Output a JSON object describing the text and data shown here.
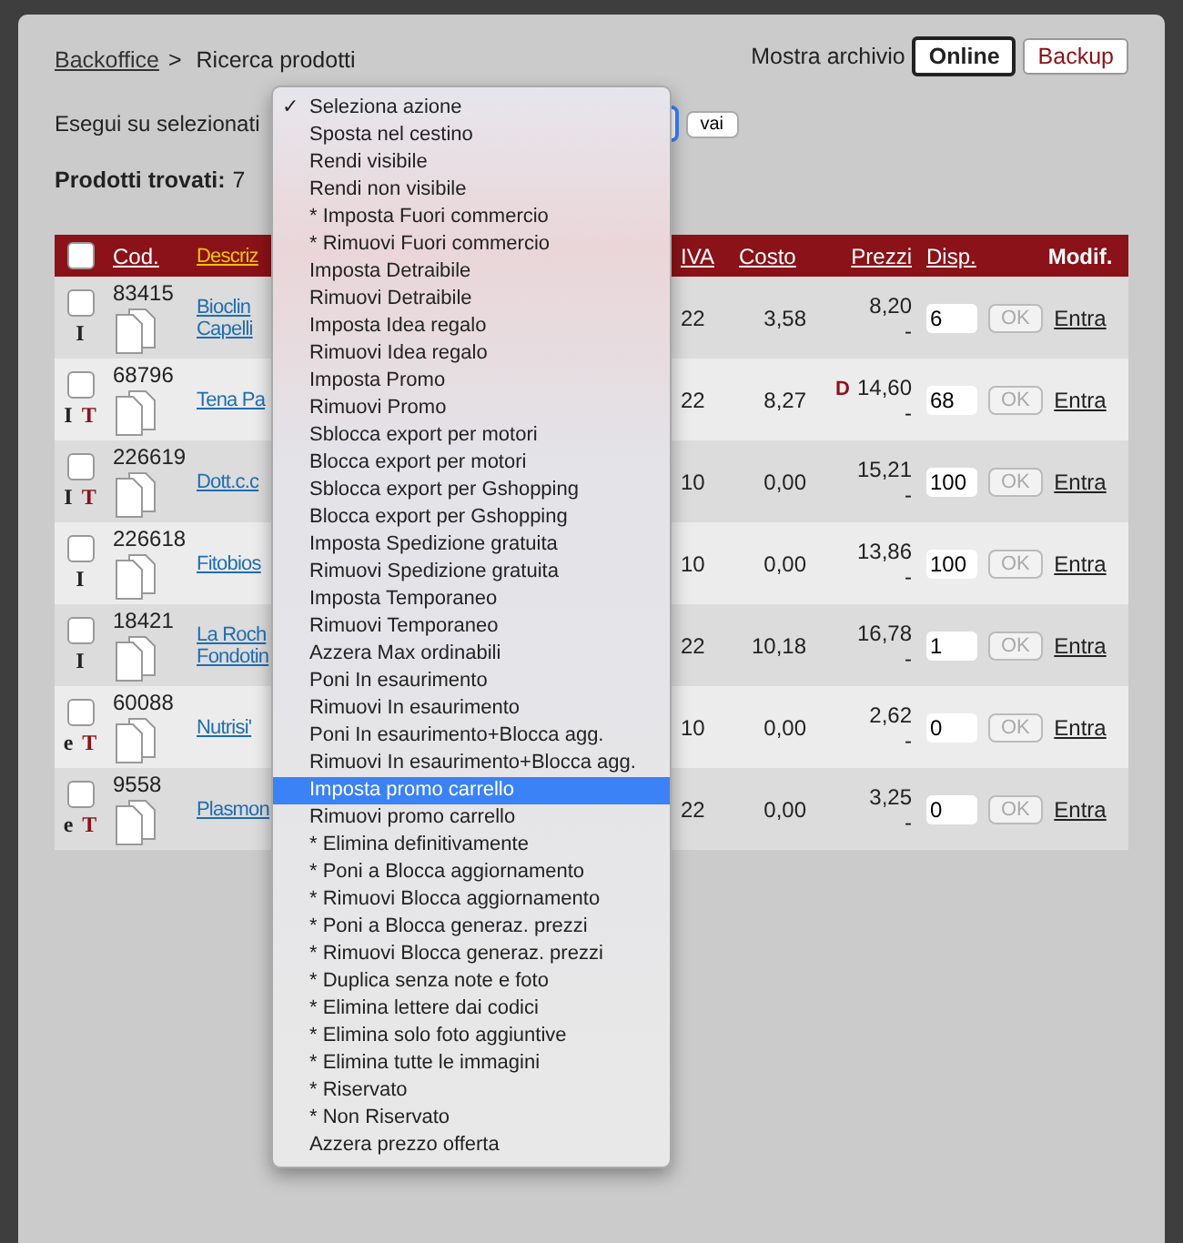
{
  "breadcrumb": {
    "link": "Backoffice",
    "separator": ">",
    "current": "Ricerca prodotti"
  },
  "archive": {
    "label": "Mostra archivio",
    "options": [
      {
        "label": "Online",
        "selected": true
      },
      {
        "label": "Backup",
        "selected": false
      }
    ]
  },
  "action_bar": {
    "label": "Esegui su selezionati",
    "go_button": "vai"
  },
  "found": {
    "label": "Prodotti trovati:",
    "count": "7"
  },
  "table": {
    "select_all_checked": false,
    "columns": [
      {
        "label": "Cod.",
        "sorted": false
      },
      {
        "label": "Descriz",
        "sorted": true
      },
      {
        "label": "IVA",
        "sorted": false
      },
      {
        "label": "Costo",
        "sorted": false
      },
      {
        "label": "Prezzi",
        "sorted": false
      },
      {
        "label": "Disp.",
        "sorted": false
      },
      {
        "label": "Modif.",
        "sorted": false
      }
    ],
    "rows": [
      {
        "checked": false,
        "flags": [
          {
            "label": "I",
            "kind": "plain"
          }
        ],
        "code": "83415",
        "description": [
          "Bioclin",
          "Capelli"
        ],
        "iva": "22",
        "cost": "3,58",
        "price_flag": "",
        "price": "8,20",
        "price_sub": "-",
        "stock": "6",
        "ok": "OK",
        "edit": "Entra"
      },
      {
        "checked": false,
        "flags": [
          {
            "label": "I",
            "kind": "plain"
          },
          {
            "label": "T",
            "kind": "red"
          }
        ],
        "code": "68796",
        "description": [
          "Tena Pa"
        ],
        "iva": "22",
        "cost": "8,27",
        "price_flag": "D",
        "price": "14,60",
        "price_sub": "-",
        "stock": "68",
        "ok": "OK",
        "edit": "Entra"
      },
      {
        "checked": false,
        "flags": [
          {
            "label": "I",
            "kind": "plain"
          },
          {
            "label": "T",
            "kind": "red"
          }
        ],
        "code": "226619",
        "description": [
          "Dott.c.c"
        ],
        "iva": "10",
        "cost": "0,00",
        "price_flag": "",
        "price": "15,21",
        "price_sub": "-",
        "stock": "100",
        "ok": "OK",
        "edit": "Entra"
      },
      {
        "checked": false,
        "flags": [
          {
            "label": "I",
            "kind": "plain"
          }
        ],
        "code": "226618",
        "description": [
          "Fitobios"
        ],
        "iva": "10",
        "cost": "0,00",
        "price_flag": "",
        "price": "13,86",
        "price_sub": "-",
        "stock": "100",
        "ok": "OK",
        "edit": "Entra"
      },
      {
        "checked": false,
        "flags": [
          {
            "label": "I",
            "kind": "plain"
          }
        ],
        "code": "18421",
        "description": [
          "La Roch",
          "Fondotin"
        ],
        "iva": "22",
        "cost": "10,18",
        "price_flag": "",
        "price": "16,78",
        "price_sub": "-",
        "stock": "1",
        "ok": "OK",
        "edit": "Entra"
      },
      {
        "checked": false,
        "flags": [
          {
            "label": "e",
            "kind": "plain"
          },
          {
            "label": "T",
            "kind": "red"
          }
        ],
        "code": "60088",
        "description": [
          "Nutrisi'"
        ],
        "iva": "10",
        "cost": "0,00",
        "price_flag": "",
        "price": "2,62",
        "price_sub": "-",
        "stock": "0",
        "ok": "OK",
        "edit": "Entra"
      },
      {
        "checked": false,
        "flags": [
          {
            "label": "e",
            "kind": "plain"
          },
          {
            "label": "T",
            "kind": "red"
          }
        ],
        "code": "9558",
        "description": [
          "Plasmon"
        ],
        "iva": "22",
        "cost": "0,00",
        "price_flag": "",
        "price": "3,25",
        "price_sub": "-",
        "stock": "0",
        "ok": "OK",
        "edit": "Entra"
      }
    ]
  },
  "action_menu": {
    "check_mark": "✓",
    "items": [
      {
        "label": "Seleziona azione",
        "checked": true,
        "selected": false
      },
      {
        "label": "Sposta nel cestino",
        "checked": false,
        "selected": false
      },
      {
        "label": "Rendi visibile",
        "checked": false,
        "selected": false
      },
      {
        "label": "Rendi non visibile",
        "checked": false,
        "selected": false
      },
      {
        "label": "* Imposta Fuori commercio",
        "checked": false,
        "selected": false
      },
      {
        "label": "* Rimuovi Fuori commercio",
        "checked": false,
        "selected": false
      },
      {
        "label": "Imposta Detraibile",
        "checked": false,
        "selected": false
      },
      {
        "label": "Rimuovi Detraibile",
        "checked": false,
        "selected": false
      },
      {
        "label": "Imposta Idea regalo",
        "checked": false,
        "selected": false
      },
      {
        "label": "Rimuovi Idea regalo",
        "checked": false,
        "selected": false
      },
      {
        "label": "Imposta Promo",
        "checked": false,
        "selected": false
      },
      {
        "label": "Rimuovi Promo",
        "checked": false,
        "selected": false
      },
      {
        "label": "Sblocca export per motori",
        "checked": false,
        "selected": false
      },
      {
        "label": "Blocca export per motori",
        "checked": false,
        "selected": false
      },
      {
        "label": "Sblocca export per Gshopping",
        "checked": false,
        "selected": false
      },
      {
        "label": "Blocca export per Gshopping",
        "checked": false,
        "selected": false
      },
      {
        "label": "Imposta Spedizione gratuita",
        "checked": false,
        "selected": false
      },
      {
        "label": "Rimuovi Spedizione gratuita",
        "checked": false,
        "selected": false
      },
      {
        "label": "Imposta Temporaneo",
        "checked": false,
        "selected": false
      },
      {
        "label": "Rimuovi Temporaneo",
        "checked": false,
        "selected": false
      },
      {
        "label": "Azzera Max ordinabili",
        "checked": false,
        "selected": false
      },
      {
        "label": "Poni In esaurimento",
        "checked": false,
        "selected": false
      },
      {
        "label": "Rimuovi In esaurimento",
        "checked": false,
        "selected": false
      },
      {
        "label": "Poni In esaurimento+Blocca agg.",
        "checked": false,
        "selected": false
      },
      {
        "label": "Rimuovi In esaurimento+Blocca agg.",
        "checked": false,
        "selected": false
      },
      {
        "label": "Imposta promo carrello",
        "checked": false,
        "selected": true
      },
      {
        "label": "Rimuovi promo carrello",
        "checked": false,
        "selected": false
      },
      {
        "label": "* Elimina definitivamente",
        "checked": false,
        "selected": false
      },
      {
        "label": "* Poni a Blocca aggiornamento",
        "checked": false,
        "selected": false
      },
      {
        "label": "* Rimuovi Blocca aggiornamento",
        "checked": false,
        "selected": false
      },
      {
        "label": "* Poni a Blocca generaz. prezzi",
        "checked": false,
        "selected": false
      },
      {
        "label": "* Rimuovi Blocca generaz. prezzi",
        "checked": false,
        "selected": false
      },
      {
        "label": "* Duplica senza note e foto",
        "checked": false,
        "selected": false
      },
      {
        "label": "* Elimina lettere dai codici",
        "checked": false,
        "selected": false
      },
      {
        "label": "* Elimina solo foto aggiuntive",
        "checked": false,
        "selected": false
      },
      {
        "label": "* Elimina tutte le immagini",
        "checked": false,
        "selected": false
      },
      {
        "label": "* Riservato",
        "checked": false,
        "selected": false
      },
      {
        "label": "* Non Riservato",
        "checked": false,
        "selected": false
      },
      {
        "label": "Azzera prezzo offerta",
        "checked": false,
        "selected": false
      }
    ]
  }
}
